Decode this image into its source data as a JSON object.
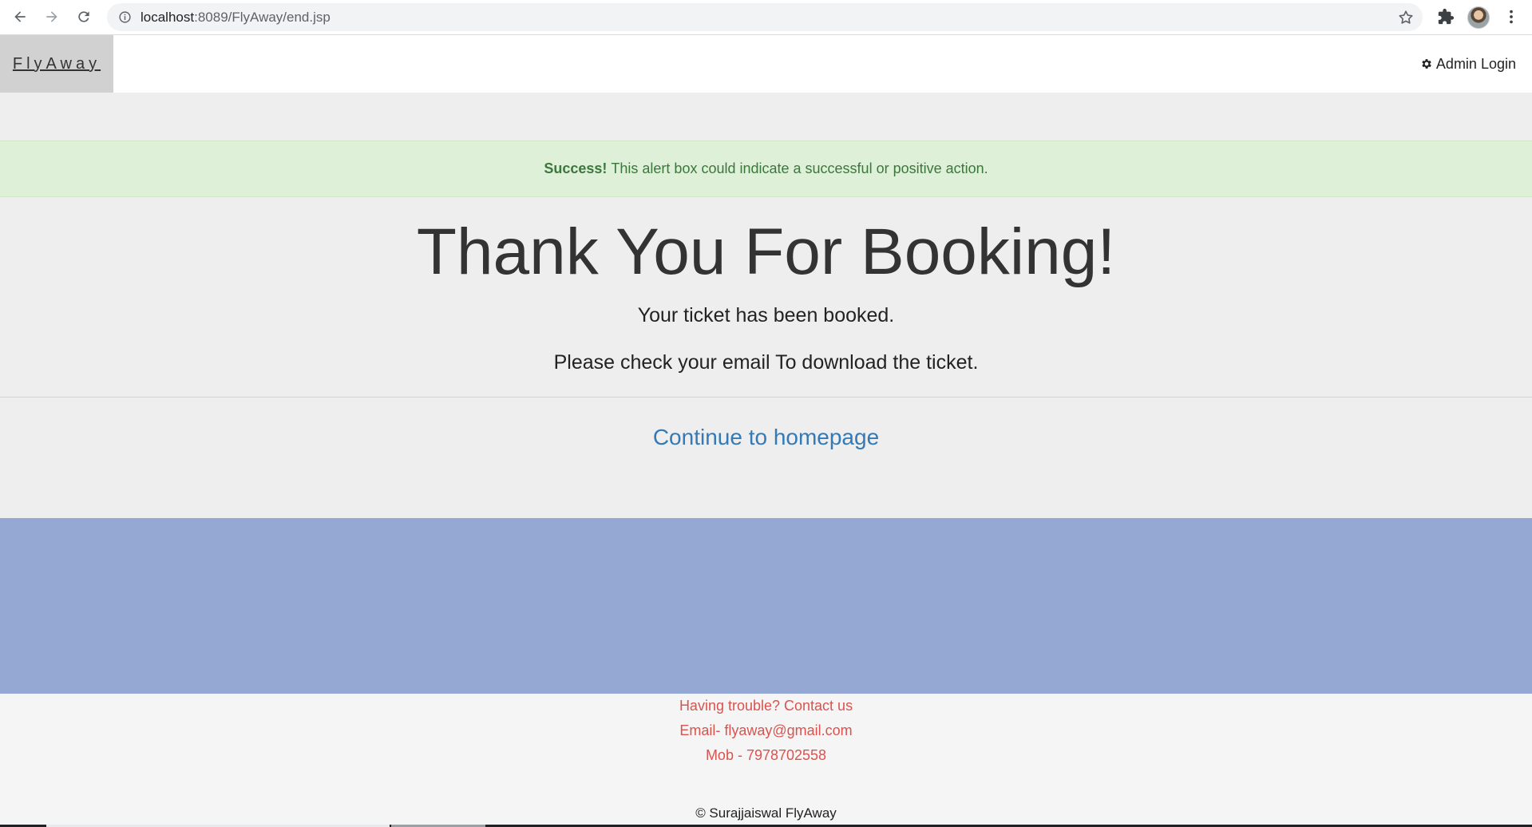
{
  "browser": {
    "url_host": "localhost",
    "url_rest": ":8089/FlyAway/end.jsp",
    "icons": [
      "back-arrow-icon",
      "forward-arrow-icon",
      "reload-icon",
      "info-icon",
      "star-icon",
      "extensions-icon",
      "avatar",
      "menu-dots-icon"
    ]
  },
  "navbar": {
    "brand": "FlyAway",
    "admin_login": "Admin Login",
    "admin_icon": "gear-icon"
  },
  "alert": {
    "strong": "Success!",
    "message": "This alert box could indicate a successful or positive action."
  },
  "main": {
    "title": "Thank You For Booking!",
    "line1": "Your ticket has been booked.",
    "line2": "Please check your email To download the ticket.",
    "continue_link": "Continue to homepage"
  },
  "footer": {
    "trouble": "Having trouble? Contact us",
    "email": "Email- flyaway@gmail.com",
    "mobile": "Mob - 7978702558",
    "copyright": "© Surajjaiswal FlyAway"
  },
  "colors": {
    "alert_bg": "#dff0d8",
    "alert_text": "#3c763d",
    "link": "#337ab7",
    "band": "#94a8d3",
    "footer_text": "#d9534f"
  }
}
